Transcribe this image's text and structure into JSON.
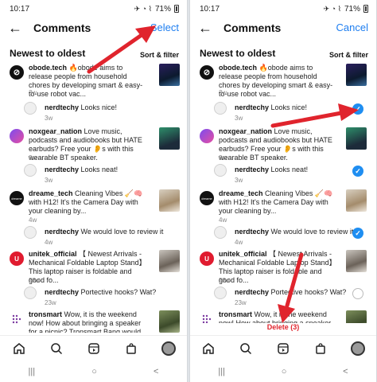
{
  "status": {
    "time": "10:17",
    "battery": "71%"
  },
  "left": {
    "title": "Comments",
    "action": "Select",
    "sort_label": "Newest to oldest",
    "sort_filter": "Sort & filter"
  },
  "right": {
    "title": "Comments",
    "action": "Cancel",
    "sort_label": "Newest to oldest",
    "sort_filter": "Sort & filter",
    "delete_label": "Delete (3)"
  },
  "comments": [
    {
      "user": "obode.tech",
      "text": "🔥obode aims to release people from household chores by developing smart & easy-to-use robot vac...",
      "age": "3w",
      "reply": false,
      "selected": false
    },
    {
      "user": "nerdtechy",
      "text": "Looks nice!",
      "age": "3w",
      "reply": true,
      "selected": true
    },
    {
      "user": "noxgear_nation",
      "text": "Love music, podcasts and audiobooks but HATE earbuds? Free your 👂s with this wearable BT speaker.",
      "age": "3w",
      "reply": false,
      "selected": false
    },
    {
      "user": "nerdtechy",
      "text": "Looks neat!",
      "age": "3w",
      "reply": true,
      "selected": true
    },
    {
      "user": "dreame_tech",
      "text": "Cleaning Vibes 🧹🧠 with H12! It's the Camera Day with your cleaning by...",
      "age": "4w",
      "reply": false,
      "selected": false
    },
    {
      "user": "nerdtechy",
      "text": "We would love to review it",
      "age": "4w",
      "reply": true,
      "selected": true
    },
    {
      "user": "unitek_official",
      "text": "【 Newest Arrivals - Mechanical Foldable Laptop Stand】 This laptop raiser is foldable and good fo...",
      "age": "23w",
      "reply": false,
      "selected": false
    },
    {
      "user": "nerdtechy",
      "text": "Portective hooks? Wat?",
      "age": "23w",
      "reply": true,
      "selected": false
    },
    {
      "user": "tronsmart",
      "text": "Wow, it is the weekend now! How about bringing a speaker for a picnic? Tronsmart Bang would be the optimal ch...",
      "age": "",
      "reply": false,
      "selected": false
    }
  ],
  "icons": {
    "back": "arrow-left-icon",
    "home": "home-icon",
    "search": "search-icon",
    "reels": "reels-icon",
    "shop": "shop-icon",
    "profile": "profile-avatar"
  },
  "nav": {
    "recent": "|||",
    "home": "○",
    "back": "<"
  },
  "colors": {
    "accent": "#1e7ef0",
    "arrow": "#e0242d",
    "check": "#1f8ef1"
  }
}
